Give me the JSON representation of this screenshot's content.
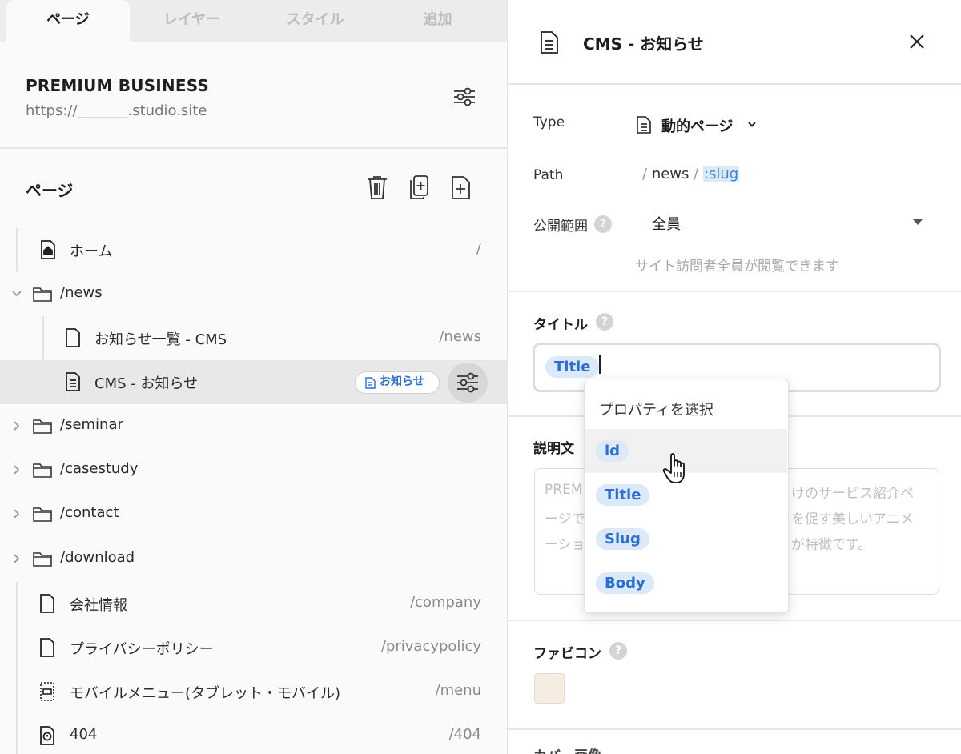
{
  "tabs": [
    {
      "label": "ページ",
      "active": true
    },
    {
      "label": "レイヤー",
      "active": false
    },
    {
      "label": "スタイル",
      "active": false
    },
    {
      "label": "追加",
      "active": false
    }
  ],
  "site": {
    "title": "PREMIUM BUSINESS",
    "url": "https://_______.studio.site"
  },
  "pages_section": {
    "heading": "ページ",
    "tools": [
      "trash-icon",
      "duplicate-page-icon",
      "add-page-icon"
    ]
  },
  "pages": [
    {
      "label": "ホーム",
      "path": "/",
      "icon": "home-page-icon"
    },
    {
      "label": "/news",
      "path": "",
      "icon": "folder-icon",
      "expanded": true
    },
    {
      "label": "お知らせ一覧 - CMS",
      "path": "/news",
      "icon": "page-icon"
    },
    {
      "label": "CMS - お知らせ",
      "path": "",
      "icon": "cms-page-icon",
      "selected": true,
      "badge": "お知らせ"
    },
    {
      "label": "/seminar",
      "path": "",
      "icon": "folder-icon"
    },
    {
      "label": "/casestudy",
      "path": "",
      "icon": "folder-icon"
    },
    {
      "label": "/contact",
      "path": "",
      "icon": "folder-icon"
    },
    {
      "label": "/download",
      "path": "",
      "icon": "folder-icon"
    },
    {
      "label": "会社情報",
      "path": "/company",
      "icon": "page-icon"
    },
    {
      "label": "プライバシーポリシー",
      "path": "/privacypolicy",
      "icon": "page-icon"
    },
    {
      "label": "モバイルメニュー(タブレット・モバイル)",
      "path": "/menu",
      "icon": "menu-page-icon"
    },
    {
      "label": "404",
      "path": "/404",
      "icon": "error-page-icon"
    }
  ],
  "panel": {
    "title": "CMS - お知らせ",
    "type_label": "Type",
    "type_value": "動的ページ",
    "path_label": "Path",
    "path_sep": "/",
    "path_segment": "news",
    "path_slug": ":slug",
    "visibility_label": "公開範囲",
    "visibility_value": "全員",
    "visibility_desc": "サイト訪問者全員が閲覧できます",
    "title_label": "タイトル",
    "title_chip": "Title",
    "desc_label": "説明文",
    "desc_ghost": [
      "PREM",
      "けのサービス紹介ペ",
      "ージで",
      "を促す美しいアニメ",
      "ーショ",
      "が特徴です。"
    ],
    "favicon_label": "ファビコン",
    "cut_label": "カバー画像",
    "help": "?"
  },
  "dropdown": {
    "heading": "プロパティを選択",
    "items": [
      "id",
      "Title",
      "Slug",
      "Body"
    ],
    "hovered": "id"
  },
  "colors": {
    "accent": "#2a6fd6",
    "chip_bg": "#dbe9f8",
    "selected_row": "#e8e8e8"
  }
}
